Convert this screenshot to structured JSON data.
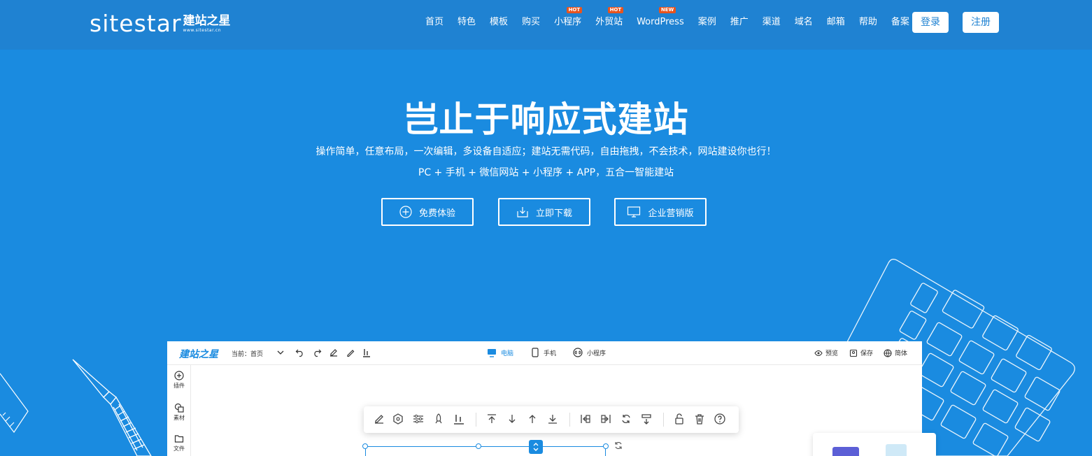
{
  "header": {
    "logo_en": "sitestar",
    "logo_cn": "建站之星",
    "logo_url": "www.sitestar.cn",
    "nav": [
      {
        "label": "首页",
        "badge": ""
      },
      {
        "label": "特色",
        "badge": ""
      },
      {
        "label": "模板",
        "badge": ""
      },
      {
        "label": "购买",
        "badge": ""
      },
      {
        "label": "小程序",
        "badge": "HOT"
      },
      {
        "label": "外贸站",
        "badge": "HOT"
      },
      {
        "label": "WordPress",
        "badge": "NEW"
      },
      {
        "label": "案例",
        "badge": ""
      },
      {
        "label": "推广",
        "badge": ""
      },
      {
        "label": "渠道",
        "badge": ""
      },
      {
        "label": "域名",
        "badge": ""
      },
      {
        "label": "邮箱",
        "badge": ""
      },
      {
        "label": "帮助",
        "badge": ""
      },
      {
        "label": "备案",
        "badge": ""
      }
    ],
    "login": "登录",
    "register": "注册"
  },
  "hero": {
    "title": "岂止于响应式建站",
    "subtitle1": "操作简单，任意布局，一次编辑，多设备自适应；建站无需代码，自由拖拽，不会技术，网站建设你也行！",
    "subtitle2": "PC + 手机 + 微信网站 + 小程序 + APP，五合一智能建站",
    "cta": [
      "免费体验",
      "立即下载",
      "企业营销版"
    ]
  },
  "editor": {
    "logo": "建站之星",
    "current_page": "当前：首页",
    "devices": [
      "电脑",
      "手机",
      "小程序"
    ],
    "actions": [
      "预览",
      "保存",
      "简体"
    ],
    "sidebar": [
      "插件",
      "素材",
      "文件"
    ]
  },
  "colors": {
    "background": "#1a8be0",
    "header": "#1f82d2",
    "badge": "#e8541e"
  }
}
